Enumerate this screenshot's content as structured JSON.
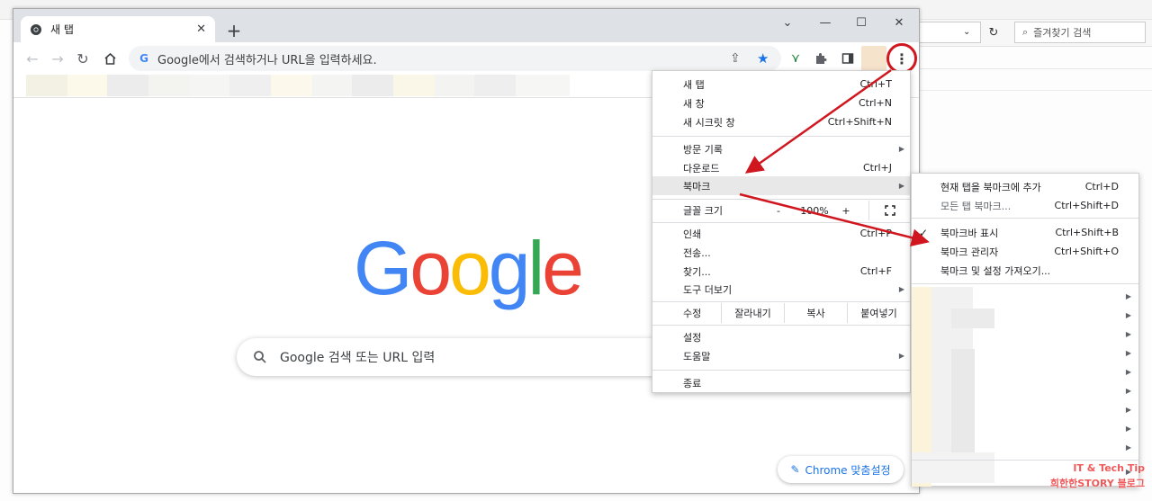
{
  "background_window": {
    "search_placeholder": "즐겨찾기 검색"
  },
  "tab": {
    "title": "새 탭",
    "close": "✕",
    "new_tab": "+"
  },
  "window_controls": {
    "tabsearch": "⌄",
    "minimize": "—",
    "maximize": "☐",
    "close": "✕"
  },
  "omnibox": {
    "placeholder": "Google에서 검색하거나 URL을 입력하세요."
  },
  "page": {
    "logo_letters": [
      "G",
      "o",
      "o",
      "g",
      "l",
      "e"
    ],
    "logo_colors": [
      "#4285f4",
      "#ea4335",
      "#fbbc05",
      "#4285f4",
      "#34a853",
      "#ea4335"
    ],
    "search_placeholder": "Google 검색 또는 URL 입력",
    "customize_label": "Chrome 맞춤설정"
  },
  "menu": {
    "items_top": [
      {
        "label": "새 탭",
        "shortcut": "Ctrl+T"
      },
      {
        "label": "새 창",
        "shortcut": "Ctrl+N"
      },
      {
        "label": "새 시크릿 창",
        "shortcut": "Ctrl+Shift+N"
      }
    ],
    "items_mid": [
      {
        "label": "방문 기록",
        "shortcut": ""
      },
      {
        "label": "다운로드",
        "shortcut": "Ctrl+J"
      },
      {
        "label": "북마크",
        "shortcut": ""
      }
    ],
    "zoom": {
      "label": "글꼴 크기",
      "minus": "-",
      "value": "100%",
      "plus": "+"
    },
    "items_tools": [
      {
        "label": "인쇄",
        "shortcut": "Ctrl+P"
      },
      {
        "label": "전송...",
        "shortcut": ""
      },
      {
        "label": "찾기...",
        "shortcut": "Ctrl+F"
      },
      {
        "label": "도구 더보기",
        "shortcut": ""
      }
    ],
    "edit": {
      "label": "수정",
      "cut": "잘라내기",
      "copy": "복사",
      "paste": "붙여넣기"
    },
    "items_bottom": [
      {
        "label": "설정",
        "shortcut": ""
      },
      {
        "label": "도움말",
        "shortcut": ""
      }
    ],
    "exit": {
      "label": "종료"
    }
  },
  "bookmark_submenu": {
    "items": [
      {
        "label": "현재 탭을 북마크에 추가",
        "shortcut": "Ctrl+D"
      },
      {
        "label": "모든 탭 북마크...",
        "shortcut": "Ctrl+Shift+D"
      },
      {
        "label": "북마크바 표시",
        "shortcut": "Ctrl+Shift+B",
        "checked": "✓"
      },
      {
        "label": "북마크 관리자",
        "shortcut": "Ctrl+Shift+O"
      },
      {
        "label": "북마크 및 설정 가져오기...",
        "shortcut": ""
      }
    ]
  },
  "watermark": {
    "line1": "IT & Tech Tip",
    "line2": "희한한STORY 블로그"
  },
  "colors": {
    "accent_blue": "#1a73e8",
    "annotation_red": "#d0161e",
    "tab_strip": "#dee1e6"
  }
}
